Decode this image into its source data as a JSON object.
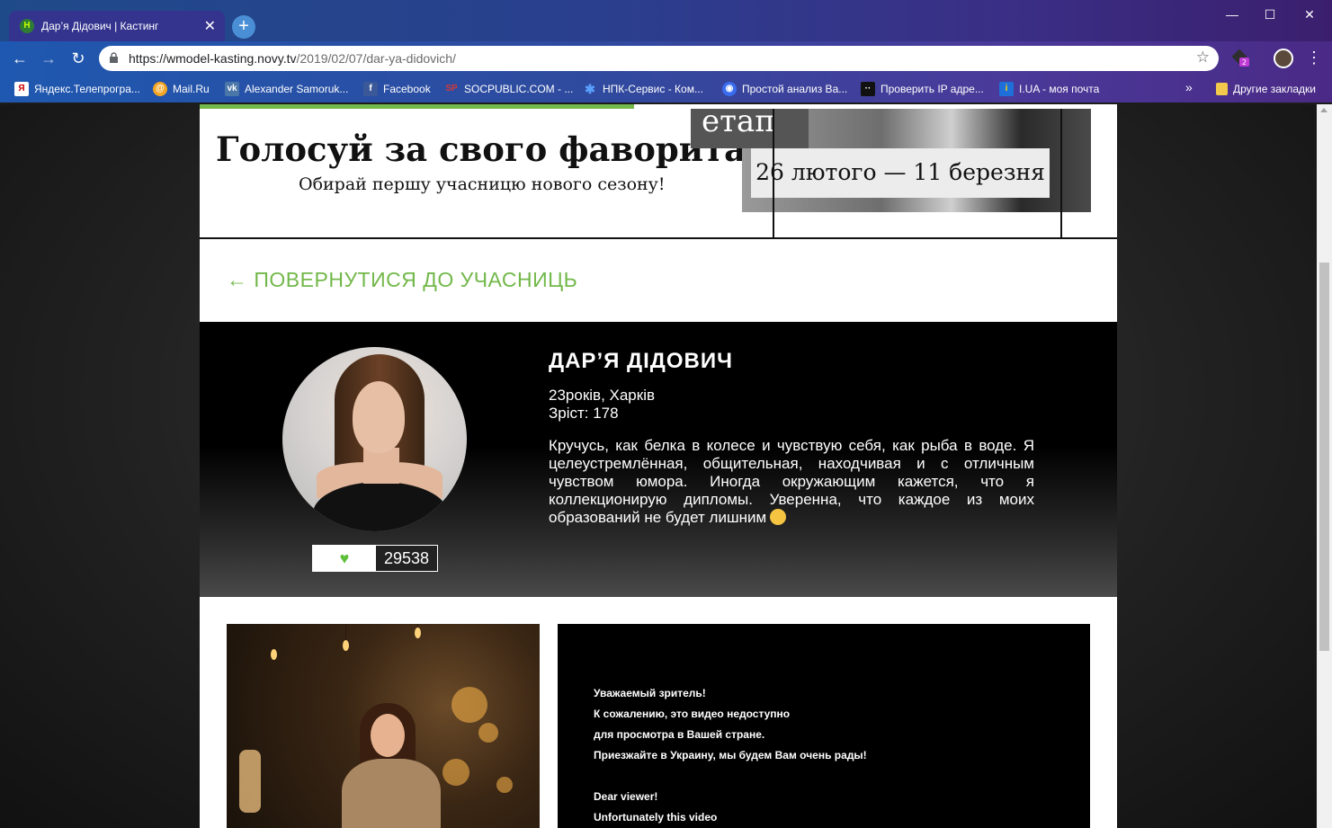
{
  "browser": {
    "tab_title": "Дар’я Дідович | Кастинг",
    "tab_favicon": "Н",
    "url_host": "https://wmodel-kasting.novy.tv",
    "url_path": "/2019/02/07/dar-ya-didovich/",
    "extension_badge": "2",
    "bookmarks": [
      {
        "label": "Яндекс.Телепрогра...",
        "icon": "yandex-icon",
        "color": "#ffcc00"
      },
      {
        "label": "Mail.Ru",
        "icon": "mailru-icon",
        "color": "#f5a623"
      },
      {
        "label": "Alexander Samoruk...",
        "icon": "vk-icon",
        "color": "#4a76a8"
      },
      {
        "label": "Facebook",
        "icon": "facebook-icon",
        "color": "#3b5998"
      },
      {
        "label": "SOCPUBLIC.COM - ...",
        "icon": "socpublic-icon",
        "color": "#d23a3a"
      },
      {
        "label": "НПК-Сервис - Ком...",
        "icon": "snowflake-icon",
        "color": "#5aa0ff"
      },
      {
        "label": "Простой анализ Ва...",
        "icon": "analysis-icon",
        "color": "#3a6cf0"
      },
      {
        "label": "Проверить IP адре...",
        "icon": "ip-icon",
        "color": "#111111"
      },
      {
        "label": "I.UA - моя почта",
        "icon": "iua-icon",
        "color": "#1e6fd9"
      }
    ],
    "bookmarks_more": "»",
    "other_bookmarks": "Другие закладки"
  },
  "banner": {
    "headline": "Голосуй за свого фаворита!",
    "subheadline": "Обирай першу учасницю нового сезону!",
    "stage": "етап",
    "dates": "26 лютого — 11 березня",
    "accent_color": "#72b84a"
  },
  "back_link": "← ПОВЕРНУТИСЯ ДО УЧАСНИЦЬ",
  "profile": {
    "name": "ДАР’Я ДІДОВИЧ",
    "age_city": "23років, Харків",
    "height": "Зріст: 178",
    "bio": "Кручусь, как белка в колесе и чувствую себя, как рыба в воде. Я целеустремлённая, общительная, находчивая и с отличным чувством юмора. Иногда окружающим кажется, что я коллекционирую дипломы. Уверенна, что каждое из моих образований не будет лишним",
    "likes": "29538"
  },
  "video_notice": {
    "line1": "Уважаемый зритель!",
    "line2": "К сожалению, это видео недоступно",
    "line3": "для просмотра в Вашей стране.",
    "line4": "Приезжайте в Украину, мы будем Вам очень рады!",
    "line5": "Dear viewer!",
    "line6": "Unfortunately this video"
  }
}
